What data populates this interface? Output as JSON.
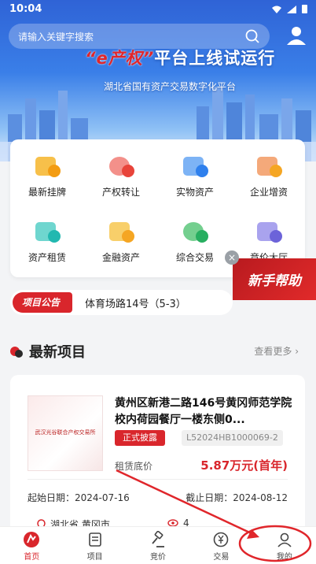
{
  "status": {
    "time": "10:04"
  },
  "search": {
    "placeholder": "请输入关键字搜索"
  },
  "banner": {
    "slogan_brand": "“e产权”",
    "slogan_rest": "平台上线试运行",
    "subtitle": "湖北省国有资产交易数字化平台"
  },
  "menu": {
    "items": [
      {
        "label": "最新挂牌",
        "icon": "new-listing-icon",
        "color": "#f5a623"
      },
      {
        "label": "产权转让",
        "icon": "equity-transfer-icon",
        "color": "#e8443a"
      },
      {
        "label": "实物资产",
        "icon": "physical-asset-icon",
        "color": "#2f80ed"
      },
      {
        "label": "企业增资",
        "icon": "capital-increase-icon",
        "color": "#f5a623"
      },
      {
        "label": "资产租赁",
        "icon": "asset-lease-icon",
        "color": "#22b8b0"
      },
      {
        "label": "金融资产",
        "icon": "financial-asset-icon",
        "color": "#f5a623"
      },
      {
        "label": "综合交易",
        "icon": "comprehensive-trade-icon",
        "color": "#27ae60"
      },
      {
        "label": "竞价大厅",
        "icon": "auction-hall-icon",
        "color": "#6c63d9"
      }
    ]
  },
  "help": {
    "label": "新手帮助",
    "close": "×"
  },
  "notice": {
    "tag": "项目公告",
    "text": "体育场路14号（5-3）"
  },
  "section": {
    "title": "最新项目",
    "more": "查看更多 ›"
  },
  "project": {
    "image_text": "武汉光谷联合产权交易所",
    "title": "黄州区新港二路146号黄冈师范学院校内荷园餐厅一楼东侧0...",
    "badge": "正式披露",
    "code": "L52024HB1000069-2",
    "price_label": "租赁底价",
    "price": "5.87万元(首年)",
    "start_date": "起始日期：2024-07-16",
    "end_date": "截止日期：2024-08-12",
    "location": "湖北省 黄冈市",
    "views": "4"
  },
  "tabs": [
    {
      "label": "首页",
      "active": true
    },
    {
      "label": "项目",
      "active": false
    },
    {
      "label": "竞价",
      "active": false
    },
    {
      "label": "交易",
      "active": false
    },
    {
      "label": "我的",
      "active": false
    }
  ],
  "colors": {
    "accent": "#d9262c",
    "banner": "#2f63d6"
  }
}
